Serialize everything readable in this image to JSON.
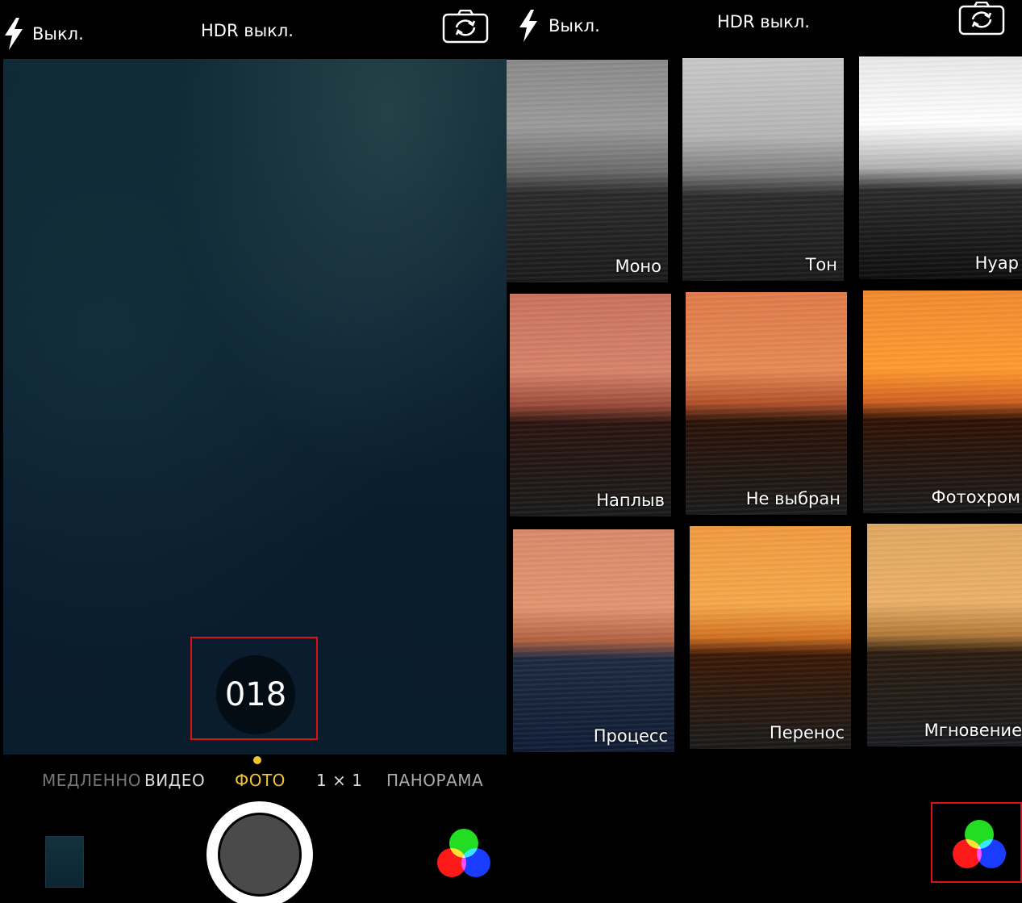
{
  "left": {
    "flash_label": "Выкл.",
    "hdr_label": "HDR выкл.",
    "timer": {
      "count": "018"
    },
    "modes": {
      "slow": "МЕДЛЕННО",
      "video": "ВИДЕО",
      "photo": "ФОТО",
      "square": "1 × 1",
      "panorama": "ПАНОРАМА"
    },
    "active_mode": "ФОТО"
  },
  "right": {
    "flash_label": "Выкл.",
    "hdr_label": "HDR выкл.",
    "filters": [
      {
        "label": "Моно"
      },
      {
        "label": "Тон"
      },
      {
        "label": "Нуар"
      },
      {
        "label": "Наплыв"
      },
      {
        "label": "Не выбран"
      },
      {
        "label": "Фотохром"
      },
      {
        "label": "Процесс"
      },
      {
        "label": "Перенос"
      },
      {
        "label": "Мгновение"
      }
    ]
  },
  "colors": {
    "accent_yellow": "#f4c430",
    "highlight_red": "#dd1111",
    "filter_red": "#ff1a1a",
    "filter_green": "#22dd22",
    "filter_blue": "#1a3cff"
  },
  "icons": {
    "flash": "flash-icon",
    "camera_switch": "camera-switch-icon",
    "filters": "filters-icon"
  }
}
